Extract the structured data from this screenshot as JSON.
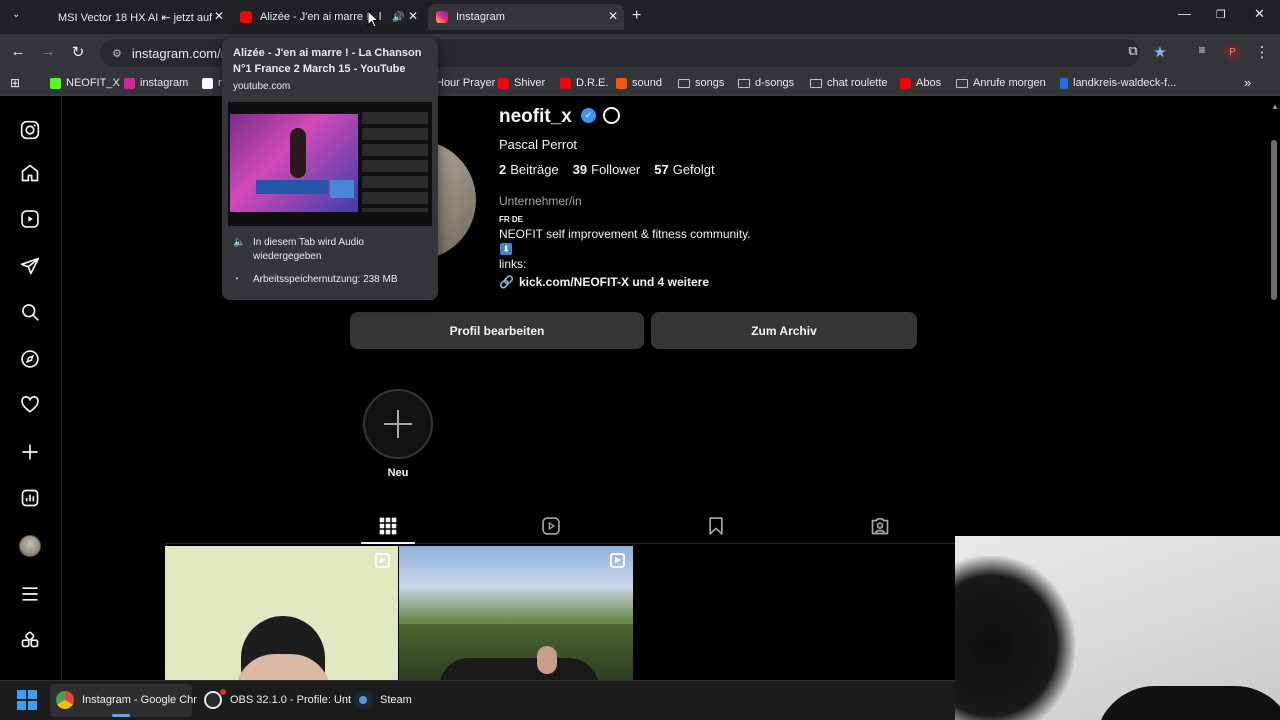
{
  "browser": {
    "tabs": [
      {
        "title": "MSI Vector 18 HX AI ⇤ jetzt auf",
        "favicon": "msi-favicon",
        "active": false
      },
      {
        "title": "Alizée - J'en ai marre ! - l",
        "favicon": "youtube-favicon",
        "audio": true,
        "active": false
      },
      {
        "title": "Instagram",
        "favicon": "instagram-favicon",
        "active": true
      }
    ],
    "new_tab_symbol": "+",
    "url": "instagram.com/ne",
    "bookmarks": [
      {
        "label": "NEOFIT_X",
        "icon": "kick-icon",
        "color": "#53fc18"
      },
      {
        "label": "instagram",
        "icon": "instagram-icon",
        "color": "#d6249f"
      },
      {
        "label": "n",
        "icon": "tiktok-icon",
        "color": "#ffffff"
      },
      {
        "label": "Hour Prayer",
        "icon": "bookmark-icon",
        "color": "#bdc1c6"
      },
      {
        "label": "Shiver",
        "icon": "youtube-icon",
        "color": "#ff0000"
      },
      {
        "label": "D.R.E.",
        "icon": "youtube-icon",
        "color": "#ff0000"
      },
      {
        "label": "sound",
        "icon": "soundcloud-icon",
        "color": "#ff5500"
      },
      {
        "label": "songs",
        "icon": "folder-icon"
      },
      {
        "label": "d-songs",
        "icon": "folder-icon"
      },
      {
        "label": "chat roulette",
        "icon": "folder-icon"
      },
      {
        "label": "Abos",
        "icon": "youtube-icon",
        "color": "#ff0000"
      },
      {
        "label": "Anrufe morgen",
        "icon": "folder-icon"
      },
      {
        "label": "landkreis-waldeck-f...",
        "icon": "site-icon",
        "color": "#1a73e8"
      }
    ],
    "more_bookmarks": "»"
  },
  "hovercard": {
    "title": "Alizée - J'en ai marre ! - La Chanson N°1 France 2 March 15 - YouTube",
    "domain": "youtube.com",
    "audio_text": "In diesem Tab wird Audio wiedergegeben",
    "memory_text": "Arbeitsspeichernutzung: 238 MB"
  },
  "profile": {
    "username": "neofit_x",
    "full_name": "Pascal Perrot",
    "stats": [
      {
        "value": "2",
        "label": "Beiträge"
      },
      {
        "value": "39",
        "label": "Follower"
      },
      {
        "value": "57",
        "label": "Gefolgt"
      }
    ],
    "category": "Unternehmer/in",
    "bio_lang": "FR DE",
    "bio_text": "NEOFIT self improvement & fitness community.",
    "bio_arrow": "⬇",
    "bio_links_label": "links:",
    "link_text": "kick.com/NEOFIT-X und 4 weitere",
    "edit_button": "Profil bearbeiten",
    "archive_button": "Zum Archiv",
    "new_story_label": "Neu"
  },
  "taskbar": {
    "items": [
      {
        "label": "Instagram - Google Chr",
        "icon": "chrome-icon"
      },
      {
        "label": "OBS 32.1.0 - Profile: Unt",
        "icon": "obs-icon"
      },
      {
        "label": "Steam",
        "icon": "steam-icon"
      }
    ]
  },
  "colors": {
    "background": "#000000",
    "chrome_dark": "#35363a",
    "button_bg": "#363636",
    "verified_blue": "#3897f0"
  }
}
